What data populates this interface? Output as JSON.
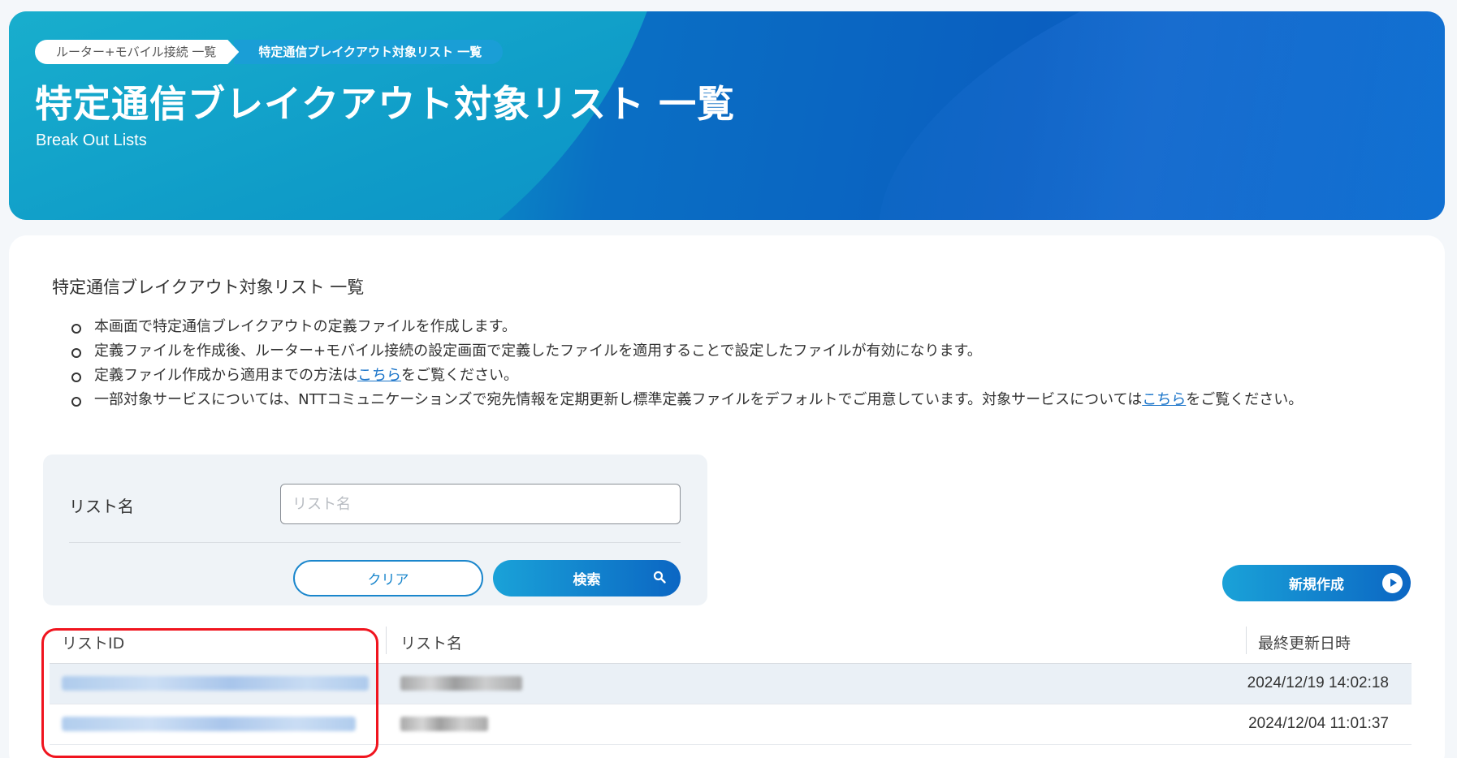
{
  "header": {
    "breadcrumbs": [
      "ルーター+モバイル接続 一覧",
      "特定通信ブレイクアウト対象リスト 一覧"
    ],
    "title": "特定通信ブレイクアウト対象リスト 一覧",
    "subtitle": "Break Out Lists"
  },
  "main": {
    "section_title": "特定通信ブレイクアウト対象リスト 一覧",
    "notes": [
      {
        "before": "本画面で特定通信ブレイクアウトの定義ファイルを作成します。",
        "link": "",
        "after": ""
      },
      {
        "before": "定義ファイルを作成後、ルーター+モバイル接続の設定画面で定義したファイルを適用することで設定したファイルが有効になります。",
        "link": "",
        "after": ""
      },
      {
        "before": "定義ファイル作成から適用までの方法は",
        "link": "こちら",
        "after": "をご覧ください。"
      },
      {
        "before": "一部対象サービスについては、NTTコミュニケーションズで宛先情報を定期更新し標準定義ファイルをデフォルトでご用意しています。対象サービスについては",
        "link": "こちら",
        "after": "をご覧ください。"
      }
    ]
  },
  "search": {
    "label": "リスト名",
    "placeholder": "リスト名",
    "value": "",
    "clear_label": "クリア",
    "search_label": "検索"
  },
  "actions": {
    "new_label": "新規作成"
  },
  "table": {
    "columns": [
      "リストID",
      "リスト名",
      "最終更新日時"
    ],
    "rows": [
      {
        "updated": "2024/12/19 14:02:18"
      },
      {
        "updated": "2024/12/04 11:01:37"
      }
    ]
  },
  "colors": {
    "accent": "#0b66c3",
    "link": "#1a74c9",
    "highlight": "#f0141e"
  }
}
